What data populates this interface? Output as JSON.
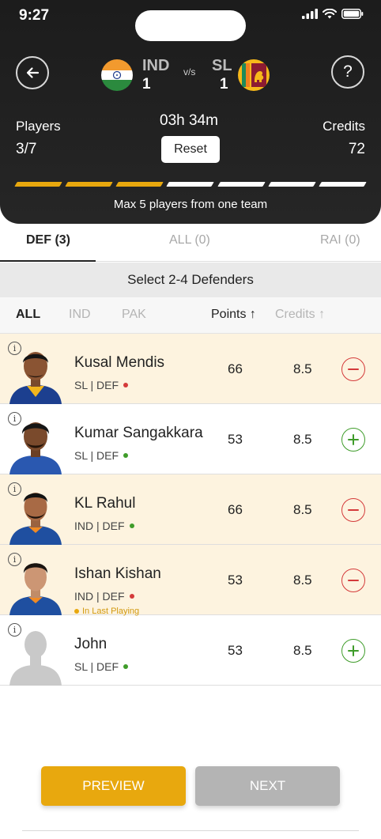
{
  "status": {
    "time": "9:27"
  },
  "match": {
    "team1": {
      "code": "IND",
      "score": "1"
    },
    "vs": "v/s",
    "team2": {
      "code": "SL",
      "score": "1"
    }
  },
  "summary": {
    "players_label": "Players",
    "players_value": "3/7",
    "timer": "03h 34m",
    "reset_label": "Reset",
    "credits_label": "Credits",
    "credits_value": "72",
    "progress_filled": 3,
    "progress_total": 7,
    "max_message": "Max 5 players from one team"
  },
  "tabs": [
    {
      "label": "DEF (3)",
      "active": true
    },
    {
      "label": "ALL (0)",
      "active": false
    },
    {
      "label": "RAI (0)",
      "active": false
    }
  ],
  "select_instruction": "Select 2-4 Defenders",
  "filters": {
    "teams": [
      "ALL",
      "IND",
      "PAK"
    ],
    "points_label": "Points ↑",
    "credits_label": "Credits ↑"
  },
  "players": [
    {
      "name": "Kusal Mendis",
      "meta": "SL | DEF",
      "status_color": "#d43a3a",
      "points": "66",
      "credits": "8.5",
      "selected": true,
      "last_playing": ""
    },
    {
      "name": "Kumar Sangakkara",
      "meta": "SL | DEF",
      "status_color": "#3f9c2a",
      "points": "53",
      "credits": "8.5",
      "selected": false,
      "last_playing": ""
    },
    {
      "name": "KL Rahul",
      "meta": "IND | DEF",
      "status_color": "#3f9c2a",
      "points": "66",
      "credits": "8.5",
      "selected": true,
      "last_playing": ""
    },
    {
      "name": "Ishan Kishan",
      "meta": "IND | DEF",
      "status_color": "#d43a3a",
      "points": "53",
      "credits": "8.5",
      "selected": true,
      "last_playing": "In Last Playing"
    },
    {
      "name": "John",
      "meta": "SL | DEF",
      "status_color": "#3f9c2a",
      "points": "53",
      "credits": "8.5",
      "selected": false,
      "last_playing": ""
    }
  ],
  "buttons": {
    "preview": "PREVIEW",
    "next": "NEXT"
  },
  "colors": {
    "accent": "#e8a80e",
    "selected_row": "#fdf3df",
    "remove": "#d43a3a",
    "add": "#3f9c2a"
  }
}
